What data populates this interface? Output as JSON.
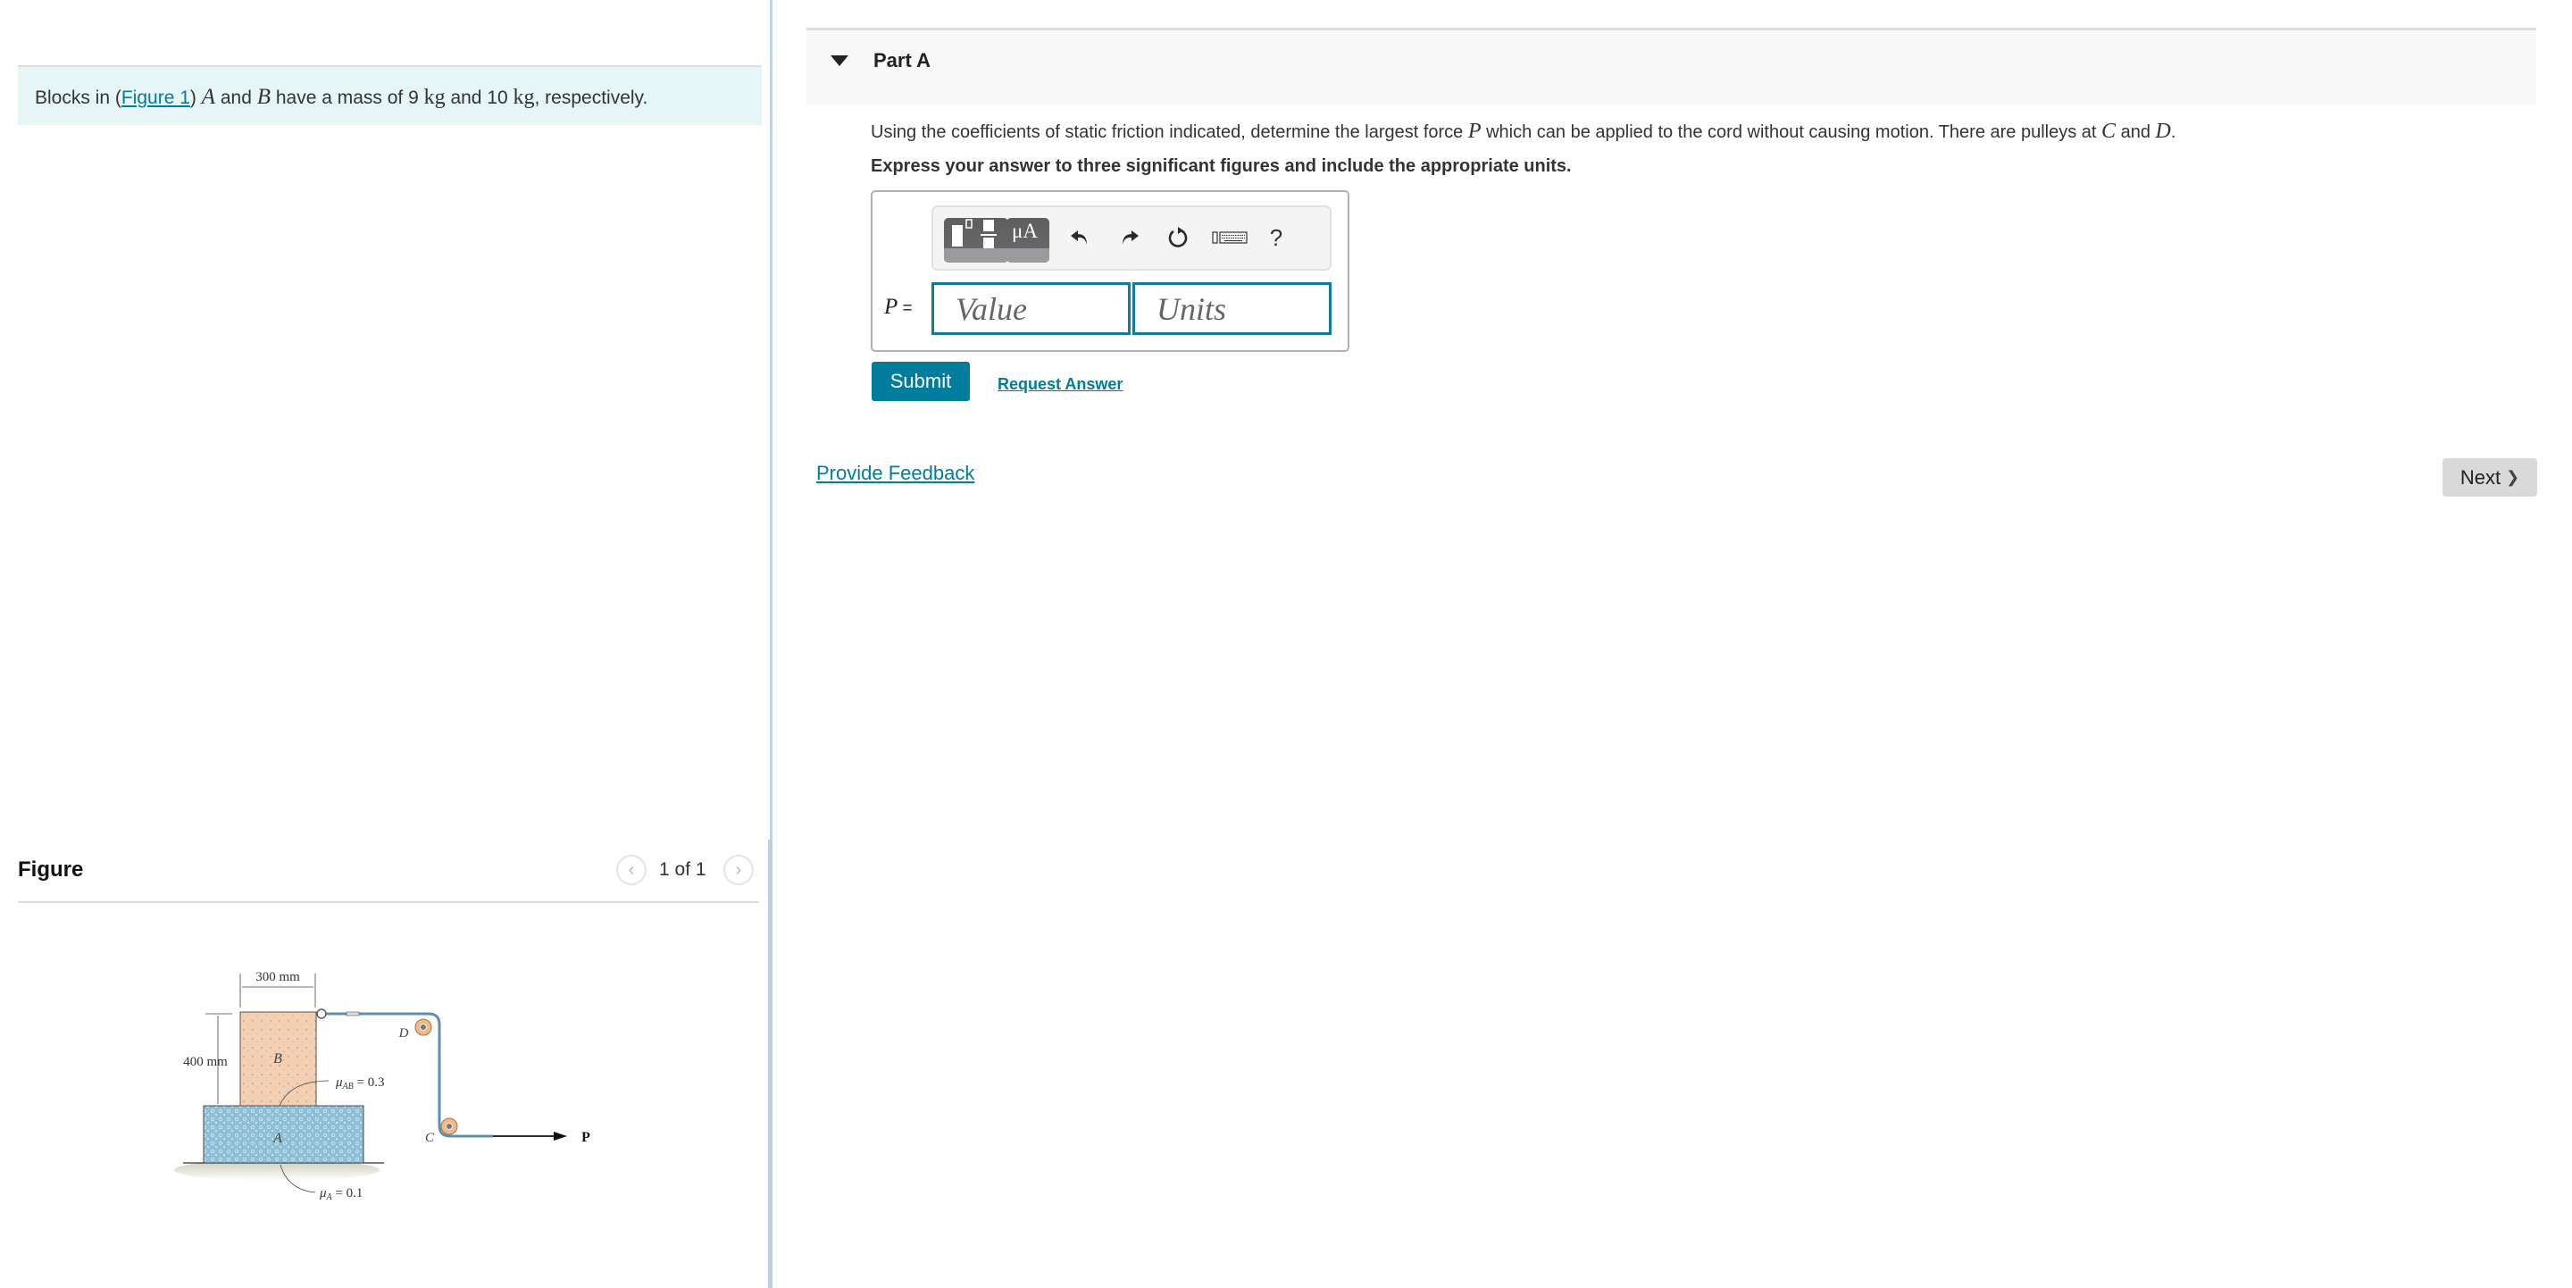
{
  "problem": {
    "prefix": "Blocks in (",
    "figure_link": "Figure 1",
    "suffix_1": ") ",
    "var_a": "A",
    "text_and": " and ",
    "var_b": "B",
    "text_mass": " have a mass of 9 ",
    "unit_kg_1": "kg",
    "text_and2": " and 10 ",
    "unit_kg_2": "kg",
    "text_end": ", respectively."
  },
  "figure_panel": {
    "title": "Figure",
    "pager_text": "1 of 1",
    "prev_icon": "‹",
    "next_icon": "›",
    "diagram": {
      "width_label": "300 mm",
      "height_label": "400 mm",
      "block_a": "A",
      "block_b": "B",
      "pulley_c": "C",
      "pulley_d": "D",
      "force": "P",
      "mu_ab": "μ",
      "mu_ab_sub": "AB",
      "mu_ab_val": " = 0.3",
      "mu_a": "μ",
      "mu_a_sub": "A",
      "mu_a_val": " = 0.1"
    }
  },
  "part_a": {
    "title": "Part A",
    "question_1": "Using the coefficients of static friction indicated, determine the largest force ",
    "question_var": "P",
    "question_2": " which can be applied to the cord without causing motion. There are pulleys at ",
    "question_c": "C",
    "question_and": " and ",
    "question_d": "D",
    "question_end": ".",
    "instruction": "Express your answer to three significant figures and include the appropriate units.",
    "answer": {
      "label_var": "P",
      "label_eq": " =",
      "value_placeholder": "Value",
      "units_placeholder": "Units",
      "value": "",
      "units": ""
    },
    "toolbar": {
      "symbols_label": "μA",
      "undo_icon": "↶",
      "redo_icon": "↷",
      "reset_icon": "↻",
      "help_label": "?"
    },
    "submit_label": "Submit",
    "request_answer_label": "Request Answer"
  },
  "feedback_label": "Provide Feedback",
  "next_label": "Next",
  "next_icon": "❯",
  "colors": {
    "accent": "#007c9c",
    "problem_bg": "#e6f6f7",
    "header_bg": "#f8f8f8",
    "next_bg": "#d9d9d9"
  }
}
